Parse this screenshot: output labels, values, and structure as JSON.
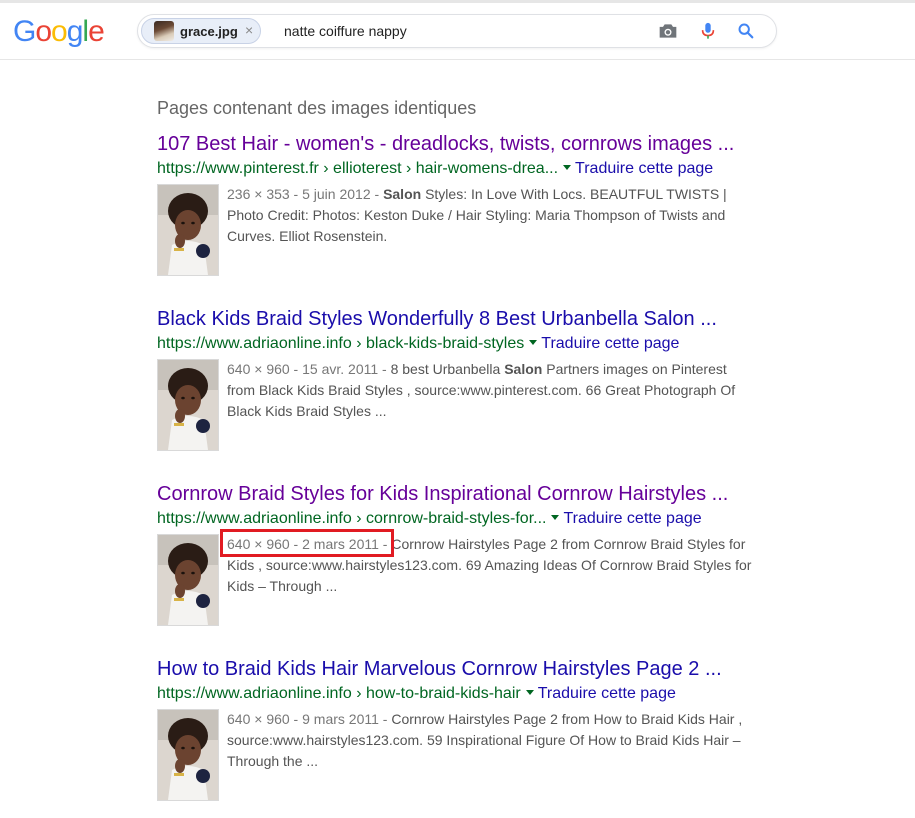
{
  "header": {
    "logo_letters": [
      {
        "char": "G",
        "color": "#4285F4"
      },
      {
        "char": "o",
        "color": "#EA4335"
      },
      {
        "char": "o",
        "color": "#FBBC05"
      },
      {
        "char": "g",
        "color": "#4285F4"
      },
      {
        "char": "l",
        "color": "#34A853"
      },
      {
        "char": "e",
        "color": "#EA4335"
      }
    ],
    "search": {
      "image_chip_label": "grace.jpg",
      "image_chip_close": "×",
      "query": "natte coiffure nappy",
      "icons": [
        "camera-icon",
        "mic-icon",
        "search-icon"
      ]
    }
  },
  "section_title": "Pages contenant des images identiques",
  "colors": {
    "title_visited": "#660099",
    "title_link": "#1a0dab",
    "url_green": "#006621",
    "highlight_red": "#e11b22"
  },
  "results": [
    {
      "title": "107 Best Hair - women's - dreadlocks, twists, cornrows images ...",
      "visited": true,
      "url": "https://www.pinterest.fr › ellioterest › hair-womens-drea...",
      "translate": "Traduire cette page",
      "meta": "236 × 353 - 5 juin 2012 - ",
      "snippet_bold": "Salon",
      "snippet_rest": " Styles: In Love With Locs. BEAUTFUL TWISTS | Photo Credit: Photos: Keston Duke / Hair Styling: Maria Thompson of Twists and Curves. Elliot Rosenstein."
    },
    {
      "title": "Black Kids Braid Styles Wonderfully 8 Best Urbanbella Salon ...",
      "visited": false,
      "url": "https://www.adriaonline.info › black-kids-braid-styles",
      "translate": "Traduire cette page",
      "meta": "640 × 960 - 15 avr. 2011 - ",
      "snippet_pre": "8 best Urbanbella ",
      "snippet_bold": "Salon",
      "snippet_rest": " Partners images on Pinterest from Black Kids Braid Styles , source:www.pinterest.com. 66 Great Photograph Of Black Kids Braid Styles ..."
    },
    {
      "title": "Cornrow Braid Styles for Kids Inspirational Cornrow Hairstyles ...",
      "visited": true,
      "url": "https://www.adriaonline.info › cornrow-braid-styles-for...",
      "translate": "Traduire cette page",
      "meta": "640 × 960 - 2 mars 2011 - ",
      "snippet_rest": "Cornrow Hairstyles Page 2 from Cornrow Braid Styles for Kids , source:www.hairstyles123.com. 69 Amazing Ideas Of Cornrow Braid Styles for Kids – Through ..."
    },
    {
      "title": "How to Braid Kids Hair Marvelous Cornrow Hairstyles Page 2 ...",
      "visited": false,
      "url": "https://www.adriaonline.info › how-to-braid-kids-hair",
      "translate": "Traduire cette page",
      "meta": "640 × 960 - 9 mars 2011 - ",
      "snippet_rest": "Cornrow Hairstyles Page 2 from How to Braid Kids Hair , source:www.hairstyles123.com. 59 Inspirational Figure Of How to Braid Kids Hair – Through the ..."
    }
  ]
}
